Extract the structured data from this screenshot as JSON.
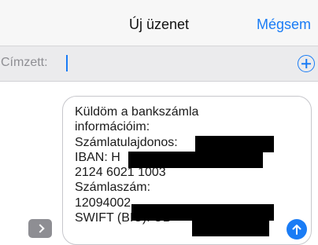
{
  "navbar": {
    "title": "Új üzenet",
    "cancel_label": "Mégsem"
  },
  "recipient": {
    "label": "Címzett:",
    "value": ""
  },
  "message": {
    "lines": [
      "Küldöm a bankszámla",
      "információim:",
      "Számlatulajdonos:",
      "IBAN: H",
      "2124 6021 1003",
      "Számlaszám:",
      "12094002",
      "SWIFT (BIC): UB"
    ]
  },
  "colors": {
    "accent": "#1a7cf5",
    "apps_button": "#8e8e93"
  },
  "icons": {
    "add": "plus-circle-icon",
    "apps": "chevron-right-icon",
    "send": "arrow-up-icon"
  }
}
